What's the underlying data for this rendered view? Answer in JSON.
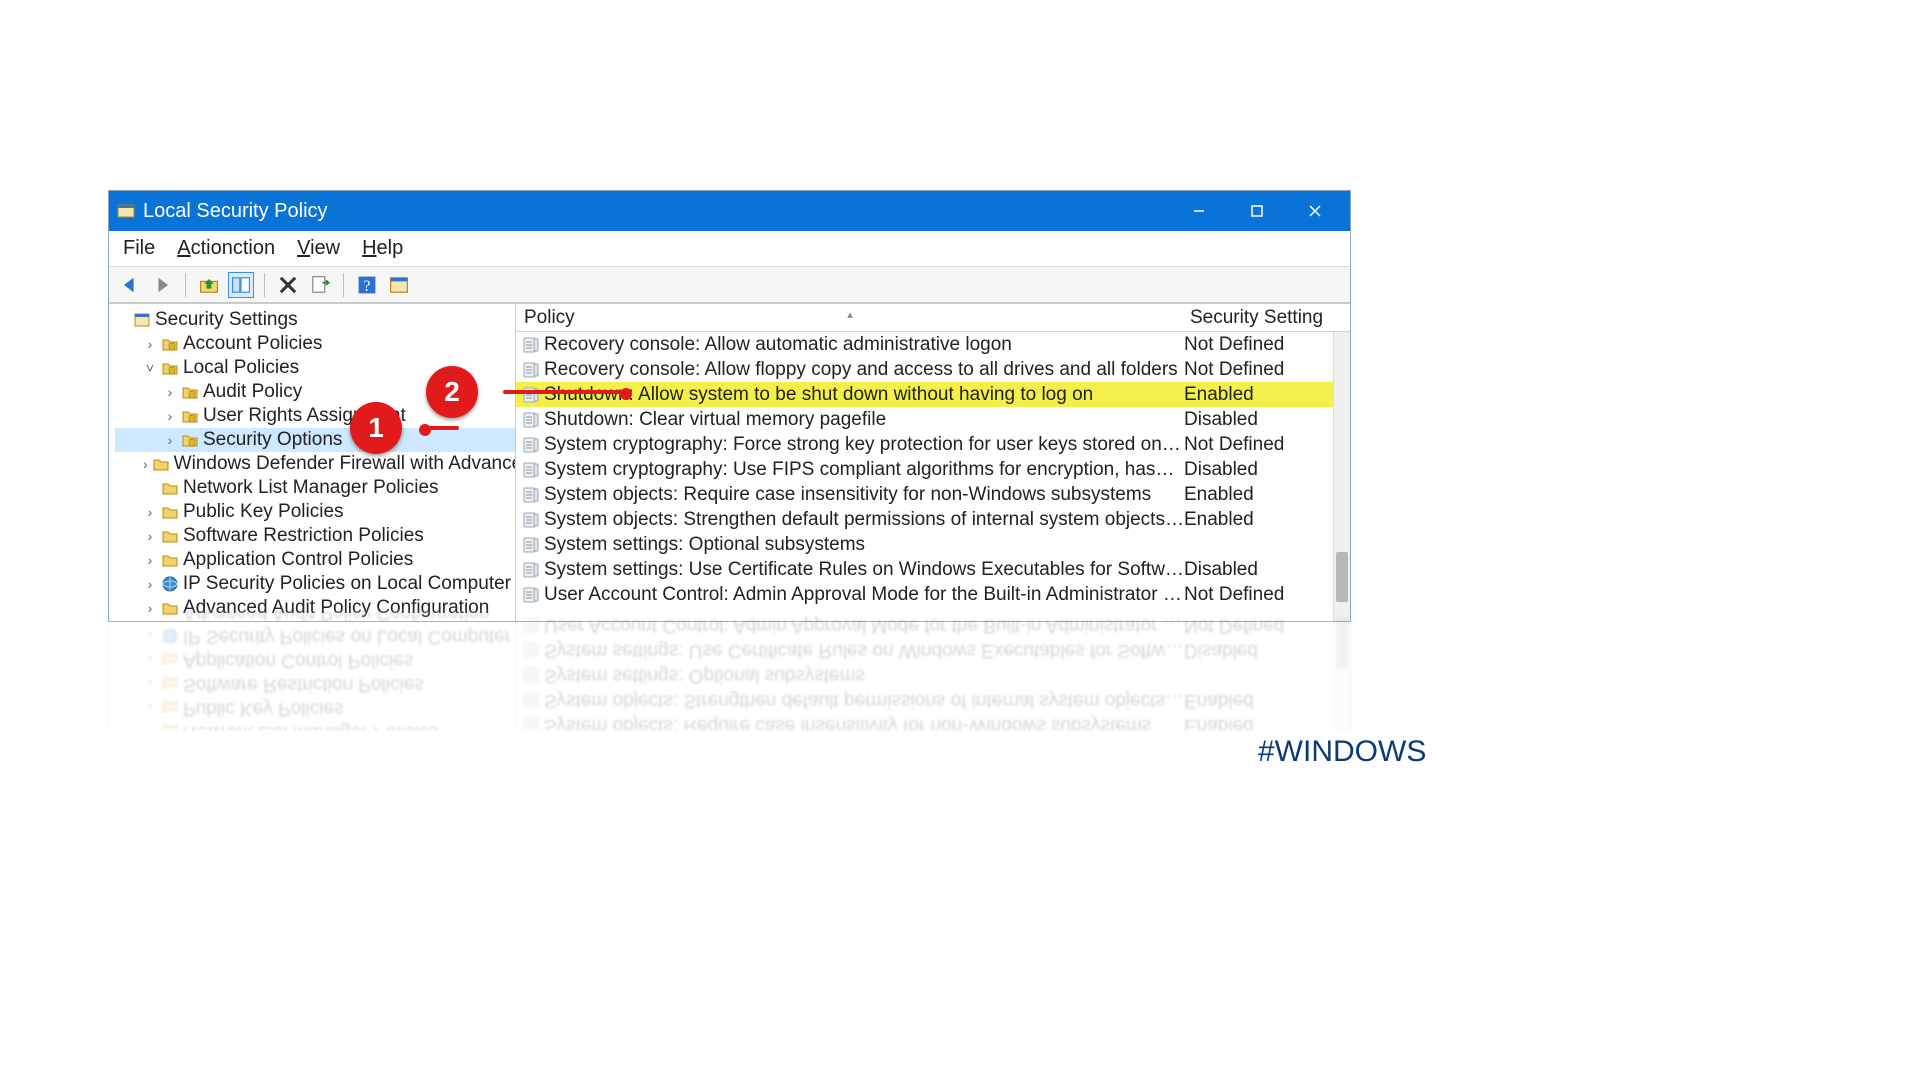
{
  "window": {
    "title": "Local Security Policy",
    "hashtag": "#WINDOWS"
  },
  "menubar": [
    "File",
    "Action",
    "View",
    "Help"
  ],
  "toolbar_icons": [
    "back-arrow-icon",
    "forward-arrow-icon",
    "up-folder-icon",
    "show-hide-tree-icon",
    "delete-icon",
    "export-icon",
    "help-icon",
    "properties-icon"
  ],
  "tree": {
    "root": "Security Settings",
    "items": [
      {
        "label": "Account Policies",
        "indent": 1,
        "twisty": ">",
        "icon": "folder-shield"
      },
      {
        "label": "Local Policies",
        "indent": 1,
        "twisty": "v",
        "icon": "folder-shield"
      },
      {
        "label": "Audit Policy",
        "indent": 2,
        "twisty": ">",
        "icon": "folder-shield"
      },
      {
        "label": "User Rights Assignment",
        "indent": 2,
        "twisty": ">",
        "icon": "folder-shield"
      },
      {
        "label": "Security Options",
        "indent": 2,
        "twisty": ">",
        "icon": "folder-shield",
        "selected": true
      },
      {
        "label": "Windows Defender Firewall with Advanced Security",
        "indent": 1,
        "twisty": ">",
        "icon": "folder"
      },
      {
        "label": "Network List Manager Policies",
        "indent": 1,
        "twisty": "",
        "icon": "folder"
      },
      {
        "label": "Public Key Policies",
        "indent": 1,
        "twisty": ">",
        "icon": "folder"
      },
      {
        "label": "Software Restriction Policies",
        "indent": 1,
        "twisty": ">",
        "icon": "folder"
      },
      {
        "label": "Application Control Policies",
        "indent": 1,
        "twisty": ">",
        "icon": "folder"
      },
      {
        "label": "IP Security Policies on Local Computer",
        "indent": 1,
        "twisty": ">",
        "icon": "globe"
      },
      {
        "label": "Advanced Audit Policy Configuration",
        "indent": 1,
        "twisty": ">",
        "icon": "folder"
      }
    ]
  },
  "list": {
    "columns": {
      "policy": "Policy",
      "setting": "Security Setting"
    },
    "rows": [
      {
        "name": "Recovery console: Allow automatic administrative logon",
        "value": "Not Defined"
      },
      {
        "name": "Recovery console: Allow floppy copy and access to all drives and all folders",
        "value": "Not Defined"
      },
      {
        "name": "Shutdown: Allow system to be shut down without having to log on",
        "value": "Enabled",
        "highlight": true
      },
      {
        "name": "Shutdown: Clear virtual memory pagefile",
        "value": "Disabled"
      },
      {
        "name": "System cryptography: Force strong key protection for user keys stored on the computer",
        "value": "Not Defined"
      },
      {
        "name": "System cryptography: Use FIPS compliant algorithms for encryption, hashing, and signing",
        "value": "Disabled"
      },
      {
        "name": "System objects: Require case insensitivity for non-Windows subsystems",
        "value": "Enabled"
      },
      {
        "name": "System objects: Strengthen default permissions of internal system objects (e.g. Symbolic Links)",
        "value": "Enabled"
      },
      {
        "name": "System settings: Optional subsystems",
        "value": ""
      },
      {
        "name": "System settings: Use Certificate Rules on Windows Executables for Software Restriction Policies",
        "value": "Disabled"
      },
      {
        "name": "User Account Control: Admin Approval Mode for the Built-in Administrator account",
        "value": "Not Defined"
      }
    ]
  },
  "annotations": {
    "callout1": "1",
    "callout2": "2"
  }
}
